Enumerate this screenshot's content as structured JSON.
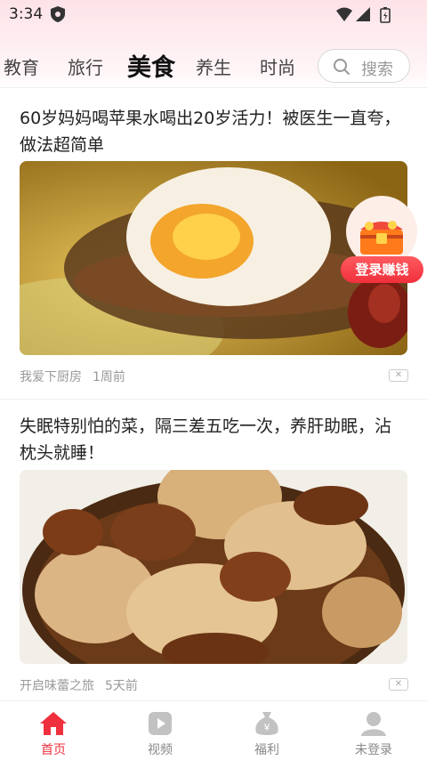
{
  "status_bar": {
    "time": "3:34"
  },
  "tabs": [
    {
      "label": "教育"
    },
    {
      "label": "旅行"
    },
    {
      "label": "美食"
    },
    {
      "label": "养生"
    },
    {
      "label": "时尚"
    }
  ],
  "active_tab": "美食",
  "search": {
    "label": "搜索"
  },
  "articles": [
    {
      "title": "60岁妈妈喝苹果水喝出20岁活力！被医生一直夸，做法超简单",
      "source": "我爱下厨房",
      "time": "1周前",
      "image": "soup-with-egg"
    },
    {
      "title": "失眠特别怕的菜，隔三差五吃一次，养肝助眠，沾枕头就睡！",
      "source": "开启味蕾之旅",
      "time": "5天前",
      "image": "braised-eggs"
    }
  ],
  "reward": {
    "label": "登录赚钱",
    "icon": "treasure-chest-icon"
  },
  "bottom_nav": [
    {
      "label": "首页",
      "icon": "home-icon",
      "active": true
    },
    {
      "label": "视频",
      "icon": "video-play-icon",
      "active": false
    },
    {
      "label": "福利",
      "icon": "money-bag-icon",
      "active": false
    },
    {
      "label": "未登录",
      "icon": "user-icon",
      "active": false
    }
  ],
  "colors": {
    "accent": "#f0303c",
    "text": "#222222",
    "muted": "#999999"
  }
}
